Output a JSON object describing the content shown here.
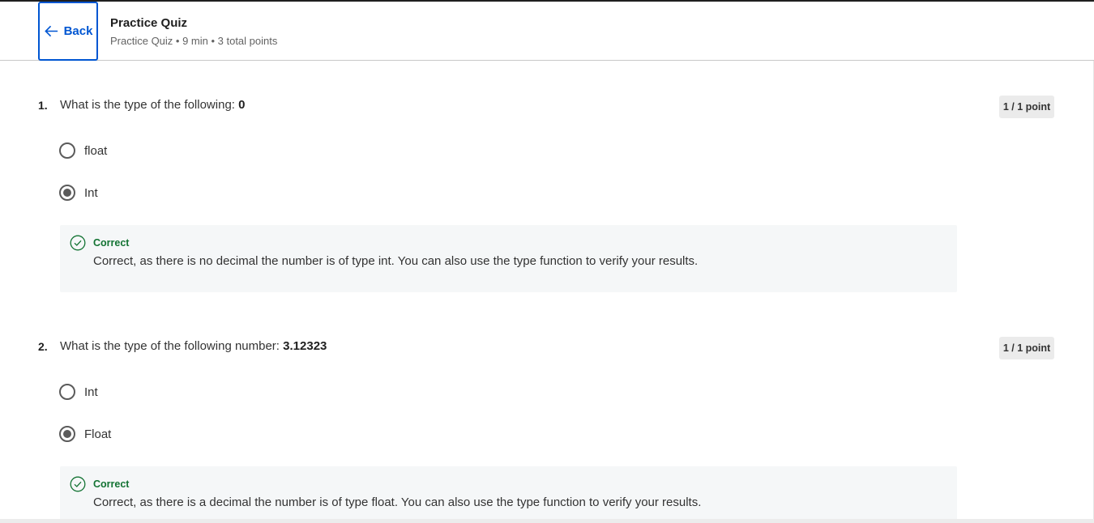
{
  "header": {
    "back_label": "Back",
    "title": "Practice Quiz",
    "subtitle": "Practice Quiz • 9 min • 3 total points"
  },
  "questions": [
    {
      "number": "1.",
      "text": "What is the type of the following: ",
      "emphasis": "0",
      "points": "1 / 1 point",
      "options": [
        {
          "label": "float",
          "selected": false
        },
        {
          "label": "Int",
          "selected": true
        }
      ],
      "feedback": {
        "status": "Correct",
        "text": "Correct, as there is no decimal the number is of type int. You can also use the type function to verify your results."
      }
    },
    {
      "number": "2.",
      "text": "What is the type of the following number: ",
      "emphasis": "3.12323",
      "points": "1 / 1 point",
      "options": [
        {
          "label": "Int",
          "selected": false
        },
        {
          "label": "Float",
          "selected": true
        }
      ],
      "feedback": {
        "status": "Correct",
        "text": "Correct, as there is a decimal the number is of type float. You can also use the type function to verify your results."
      }
    }
  ],
  "colors": {
    "accent": "#0056d2",
    "correct": "#137333",
    "feedback_bg": "#f5f7f8"
  }
}
